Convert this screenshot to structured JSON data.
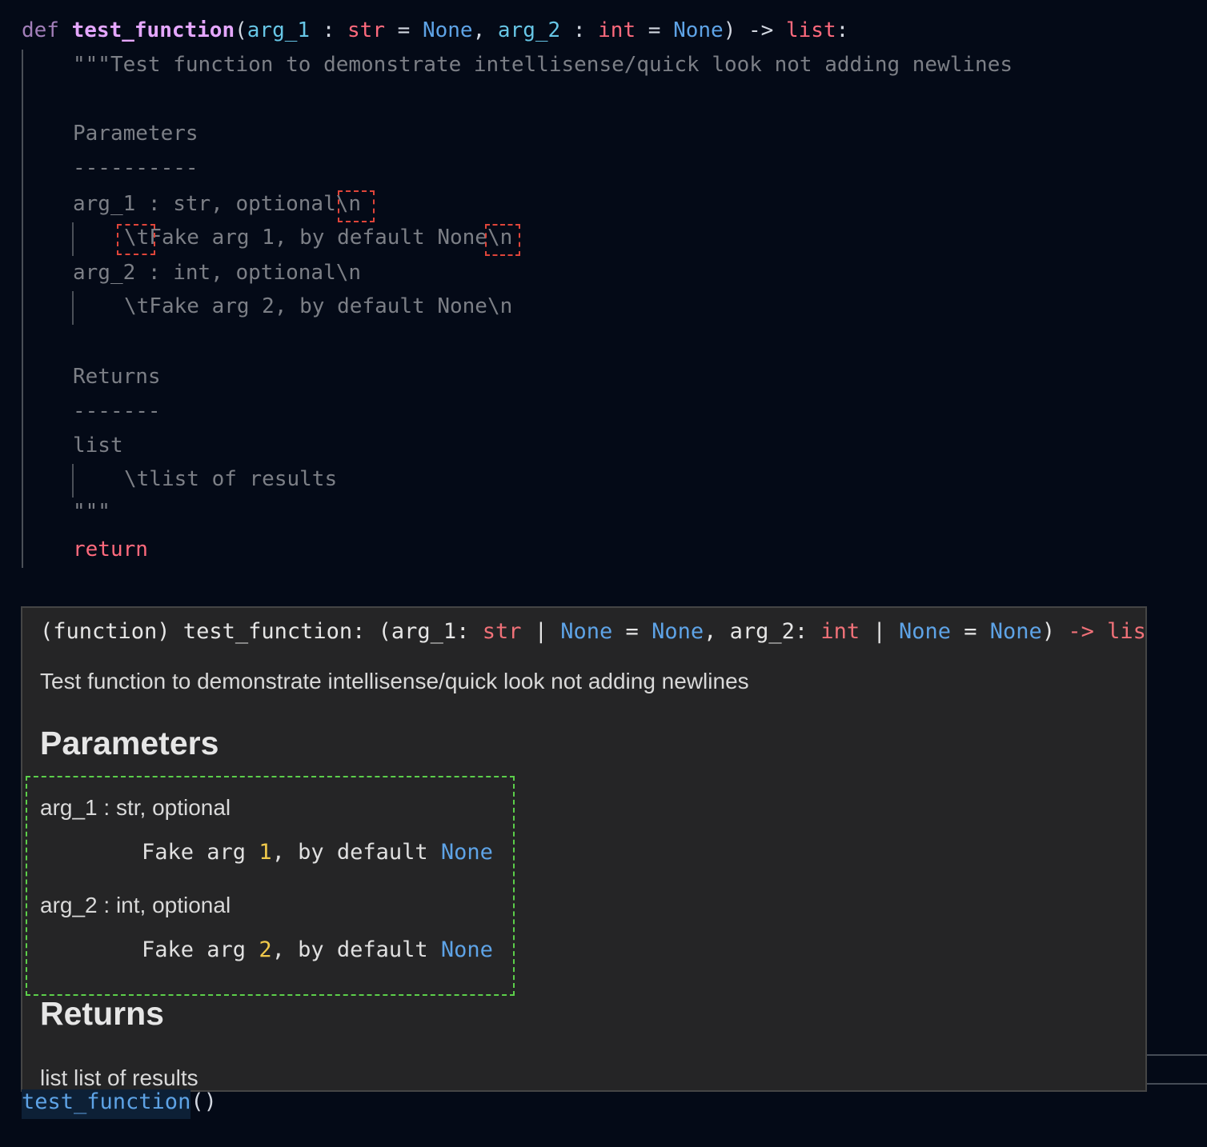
{
  "code": {
    "def_keyword": "def",
    "func_name": "test_function",
    "open_paren": "(",
    "arg1": "arg_1",
    "colon": " : ",
    "arg1_type": "str",
    "equals": " = ",
    "none": "None",
    "comma": ", ",
    "arg2": "arg_2",
    "arg2_type": "int",
    "close_arrow": ") -> ",
    "ret_type": "list",
    "end_colon": ":",
    "docstring_lines": [
      "\"\"\"Test function to demonstrate intellisense/quick look not adding newlines",
      "",
      "Parameters",
      "----------",
      "arg_1 : str, optional\\n",
      "\\tFake arg 1, by default None\\n",
      "arg_2 : int, optional\\n",
      "\\tFake arg 2, by default None\\n",
      "",
      "Returns",
      "-------",
      "list",
      "\\tlist of results",
      "\"\"\""
    ],
    "return_keyword": "return"
  },
  "tooltip": {
    "sig_prefix": "(function) test_function: (arg_1: ",
    "sig_str": "str",
    "sig_pipe1": " | ",
    "sig_none1": "None",
    "sig_eq1": " = ",
    "sig_none2": "None",
    "sig_mid": ", arg_2: ",
    "sig_int": "int",
    "sig_pipe2": " | ",
    "sig_none3": "None",
    "sig_eq2": " = ",
    "sig_none4": "None",
    "sig_close": ") ",
    "sig_arrow": "-> list",
    "description": "Test function to demonstrate intellisense/quick look not adding newlines",
    "params_heading": "Parameters",
    "arg1_line": "arg_1 : str, optional",
    "arg1_desc_pre": "Fake arg ",
    "arg1_num": "1",
    "arg1_desc_mid": ", by default ",
    "arg1_none": "None",
    "arg2_line": "arg_2 : int, optional",
    "arg2_desc_pre": "Fake arg ",
    "arg2_num": "2",
    "arg2_desc_mid": ", by default ",
    "arg2_none": "None",
    "returns_heading": "Returns",
    "returns_text": "list list of results"
  },
  "bottom": {
    "call_name": "test_function",
    "call_parens": "()"
  },
  "colors": {
    "background": "#040a17",
    "tooltip_bg": "#252526",
    "highlight_red": "#e0453a",
    "highlight_green": "#5ccf4a"
  }
}
